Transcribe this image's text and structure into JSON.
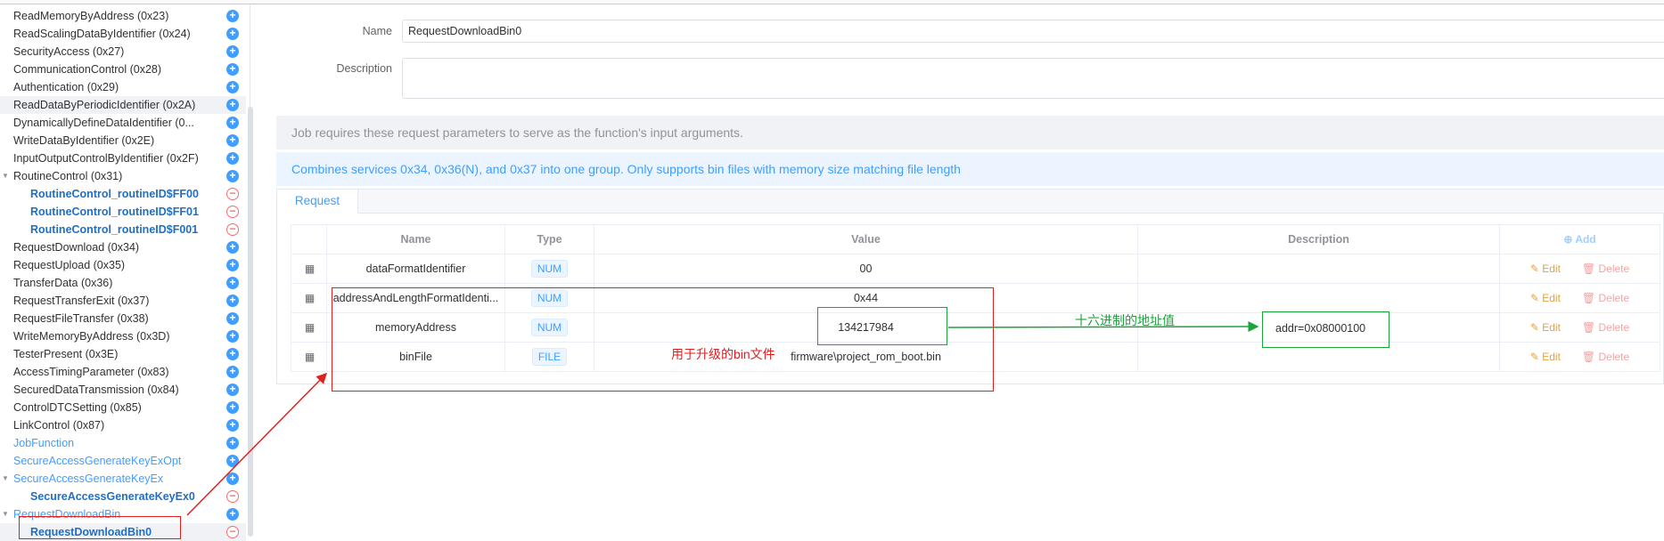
{
  "sidebar": {
    "items": [
      {
        "label": "ReadMemoryByAddress (0x23)",
        "style": "normal",
        "action": "plus"
      },
      {
        "label": "ReadScalingDataByIdentifier (0x24)",
        "style": "normal",
        "action": "plus"
      },
      {
        "label": "SecurityAccess (0x27)",
        "style": "normal",
        "action": "plus"
      },
      {
        "label": "CommunicationControl (0x28)",
        "style": "normal",
        "action": "plus"
      },
      {
        "label": "Authentication (0x29)",
        "style": "normal",
        "action": "plus"
      },
      {
        "label": "ReadDataByPeriodicIdentifier (0x2A)",
        "style": "normal",
        "action": "plus",
        "highlight": true
      },
      {
        "label": "DynamicallyDefineDataIdentifier (0...",
        "style": "normal",
        "action": "plus"
      },
      {
        "label": "WriteDataByIdentifier (0x2E)",
        "style": "normal",
        "action": "plus"
      },
      {
        "label": "InputOutputControlByIdentifier (0x2F)",
        "style": "normal",
        "action": "plus"
      },
      {
        "label": "RoutineControl (0x31)",
        "style": "normal",
        "action": "plus",
        "expanded": true
      },
      {
        "label": "RoutineControl_routineID$FF00",
        "style": "child",
        "action": "minus"
      },
      {
        "label": "RoutineControl_routineID$FF01",
        "style": "child",
        "action": "minus"
      },
      {
        "label": "RoutineControl_routineID$F001",
        "style": "child",
        "action": "minus"
      },
      {
        "label": "RequestDownload (0x34)",
        "style": "normal",
        "action": "plus"
      },
      {
        "label": "RequestUpload (0x35)",
        "style": "normal",
        "action": "plus"
      },
      {
        "label": "TransferData (0x36)",
        "style": "normal",
        "action": "plus"
      },
      {
        "label": "RequestTransferExit (0x37)",
        "style": "normal",
        "action": "plus"
      },
      {
        "label": "RequestFileTransfer (0x38)",
        "style": "normal",
        "action": "plus"
      },
      {
        "label": "WriteMemoryByAddress (0x3D)",
        "style": "normal",
        "action": "plus"
      },
      {
        "label": "TesterPresent (0x3E)",
        "style": "normal",
        "action": "plus"
      },
      {
        "label": "AccessTimingParameter (0x83)",
        "style": "normal",
        "action": "plus"
      },
      {
        "label": "SecuredDataTransmission (0x84)",
        "style": "normal",
        "action": "plus"
      },
      {
        "label": "ControlDTCSetting (0x85)",
        "style": "normal",
        "action": "plus"
      },
      {
        "label": "LinkControl (0x87)",
        "style": "normal",
        "action": "plus"
      },
      {
        "label": "JobFunction",
        "style": "link",
        "action": "plus"
      },
      {
        "label": "SecureAccessGenerateKeyExOpt",
        "style": "link",
        "action": "plus"
      },
      {
        "label": "SecureAccessGenerateKeyEx",
        "style": "link",
        "action": "plus",
        "expanded": true
      },
      {
        "label": "SecureAccessGenerateKeyEx0",
        "style": "child",
        "action": "minus"
      },
      {
        "label": "RequestDownloadBin",
        "style": "link",
        "action": "plus",
        "expanded": true
      },
      {
        "label": "RequestDownloadBin0",
        "style": "child",
        "action": "minus",
        "highlight": true
      }
    ]
  },
  "form": {
    "name_label": "Name",
    "name_value": "RequestDownloadBin0",
    "description_label": "Description",
    "description_value": ""
  },
  "notes": {
    "info": "Job requires these request parameters to serve as the function's input arguments.",
    "combine": "Combines services 0x34, 0x36(N), and 0x37 into one group. Only supports bin files with memory size matching file length"
  },
  "tabs": [
    {
      "label": "Request"
    }
  ],
  "table": {
    "headers": {
      "name": "Name",
      "type": "Type",
      "value": "Value",
      "description": "Description",
      "add": "Add"
    },
    "rows": [
      {
        "name": "dataFormatIdentifier",
        "type": "NUM",
        "value": "00",
        "description": ""
      },
      {
        "name": "addressAndLengthFormatIdenti...",
        "type": "NUM",
        "value": "0x44",
        "description": ""
      },
      {
        "name": "memoryAddress",
        "type": "NUM",
        "value": "134217984",
        "description": ""
      },
      {
        "name": "binFile",
        "type": "FILE",
        "value": "firmware\\project_rom_boot.bin",
        "description": ""
      }
    ],
    "edit_label": "Edit",
    "delete_label": "Delete"
  },
  "annotations": {
    "bin_note": "用于升级的bin文件",
    "hex_note": "十六进制的地址值",
    "addr_value": "addr=0x08000100"
  },
  "colors": {
    "accent": "#409eff",
    "annotation_red": "#e02020",
    "annotation_green": "#1aa53a",
    "edit": "#e6a23c",
    "delete": "#f56c6c"
  }
}
